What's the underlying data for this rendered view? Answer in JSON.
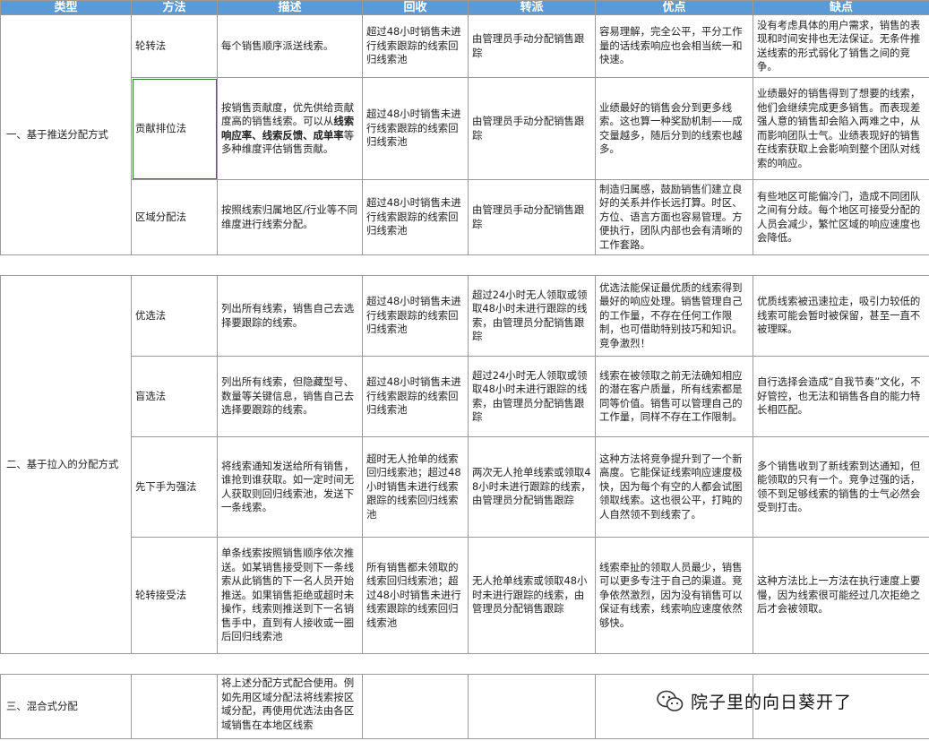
{
  "headers": [
    "类型",
    "方法",
    "描述",
    "回收",
    "转派",
    "优点",
    "缺点"
  ],
  "groups": [
    {
      "type": "一、基于推送分配方式",
      "rows": [
        {
          "method": "轮转法",
          "desc": "每个销售顺序派送线索。",
          "recycle": "超过48小时销售未进行线索跟踪的线索回归线索池",
          "transfer": "由管理员手动分配销售跟踪",
          "pros": "容易理解，完全公平，平分工作量的话线索响应也会相当统一和快速。",
          "cons": "没有考虑具体的用户需求，销售的表现和时间安排也无法保证。无条件推送线索的形式弱化了销售之间的竞争。"
        },
        {
          "method": "贡献排位法",
          "desc_a": "按销售贡献度，优先供给贡献度高的销售线索。可以从",
          "desc_b": "线索响应率、线索反馈、成单率",
          "desc_c": "等多种维度评估销售贡献。",
          "recycle": "超过48小时销售未进行线索跟踪的线索回归线索池",
          "transfer": "由管理员手动分配销售跟踪",
          "pros": "业绩最好的销售会分到更多线索。这也算一种奖励机制——成交量越多，随后分到的线索也越多。",
          "cons": "业绩最好的销售得到了想要的线索，他们会继续完成更多销售。而表现差强人意的销售却会陷入两难之中，从而影响团队士气。业绩表现好的销售在线索获取上会影响到整个团队对线索的响应。"
        },
        {
          "method": "区域分配法",
          "desc": "按照线索归属地区/行业等不同维度进行线索分配。",
          "recycle": "超过48小时销售未进行线索跟踪的线索回归线索池",
          "transfer": "由管理员手动分配销售跟踪",
          "pros": "制造归属感，鼓励销售们建立良好的关系并作长远打算。时区、方位、语言方面也容易管理。方便执行，团队内部也会有清晰的工作套路。",
          "cons": "有些地区可能偏冷门，造成不同团队之间有分歧。每个地区可接受分配的人员会减少，繁忙区域的响应速度也会降低。"
        }
      ]
    },
    {
      "type": "二、基于拉入的分配方式",
      "rows": [
        {
          "method": "优选法",
          "desc": "列出所有线索，销售自己去选择要跟踪的线索。",
          "recycle": "超过48小时销售未进行线索跟踪的线索回归线索池",
          "transfer": "超过24小时无人领取或领取48小时未进行跟踪的线索，由管理员分配销售跟踪",
          "pros": "优选法能保证最优质的线索得到最好的响应处理。销售管理自己的工作量，不存在任何工作限制，也可借助特别技巧和知识。竞争激烈！",
          "cons": "优质线索被迅速拉走，吸引力较低的线索可能会暂时被保留，甚至一直不被理睬。"
        },
        {
          "method": "盲选法",
          "desc": "列出所有线索，但隐藏型号、数量等关键信息，销售自己去选择要跟踪的线索。",
          "recycle": "超过48小时销售未进行线索跟踪的线索回归线索池",
          "transfer": "超过24小时无人领取或领取48小时未进行跟踪的线索，由管理员分配销售跟踪",
          "pros": "线索在被领取之前无法确知相应的潜在客户质量，所有线索都是同等价值。销售可以管理自己的工作量，同样不存在工作限制。",
          "cons": "自行选择会造成“自我节奏”文化，不好管控，也无法和销售各自的能力特长相匹配。"
        },
        {
          "method": "先下手为强法",
          "desc": "将线索通知发送给所有销售，谁抢到谁获取。如一定时间无人获取则回归线索池，发送下一条线索。",
          "recycle": "超时无人抢单的线索回归线索池；超过48小时销售未进行线索跟踪的线索回归线索池",
          "transfer": "两次无人抢单线索或领取48小时未进行跟踪的线索，由管理员分配销售跟踪",
          "pros": "这种方法将竞争提升到了一个新高度。它能保证线索响应速度极快，因为每个有空的人都会试图领取线索。这也很公平，打盹的人自然领不到线索了。",
          "cons": "多个销售收到了新线索到达通知，但能领取的只有一个。竞争过强的话，领不到足够线索的销售的士气必然会受到打击。"
        },
        {
          "method": "轮转接受法",
          "desc": "单条线索按照销售顺序依次推送。如某销售接受则下一条线索从此销售的下一名人员开始推送。如果销售拒绝或超时未操作，线索则推送到下一名销售手中，直到有人接收或一圈后回归线索池",
          "recycle": "所有销售都未领取的线索回归线索池；超过48小时销售未进行线索跟踪的线索回归线索池",
          "transfer": "无人抢单线索或领取48小时未进行跟踪的线索，由管理员分配销售跟踪",
          "pros": "线索牵扯的领取人员最少，销售可以更多专注于自己的渠道。竞争依然激烈，因为没有销售可以保证有线索，线索响应速度依然够快。",
          "cons": "这种方法比上一方法在执行速度上要慢，因为线索很可能经过几次拒绝之后才会被领取。"
        }
      ]
    },
    {
      "type": "三、混合式分配",
      "rows": [
        {
          "method": "",
          "desc": "将上述分配方式配合使用。例如先用区域分配法将线索按区域分配，再使用优选法由各区域销售在本地区线索",
          "recycle": "",
          "transfer": "",
          "pros": "",
          "cons": ""
        }
      ]
    }
  ],
  "watermark": {
    "text": "院子里的向日葵开了",
    "icon": "wechat-icon"
  },
  "colors": {
    "header_bg": "#5b9bd5",
    "header_text": "#ffffff",
    "grid": "#9a9a9a"
  }
}
